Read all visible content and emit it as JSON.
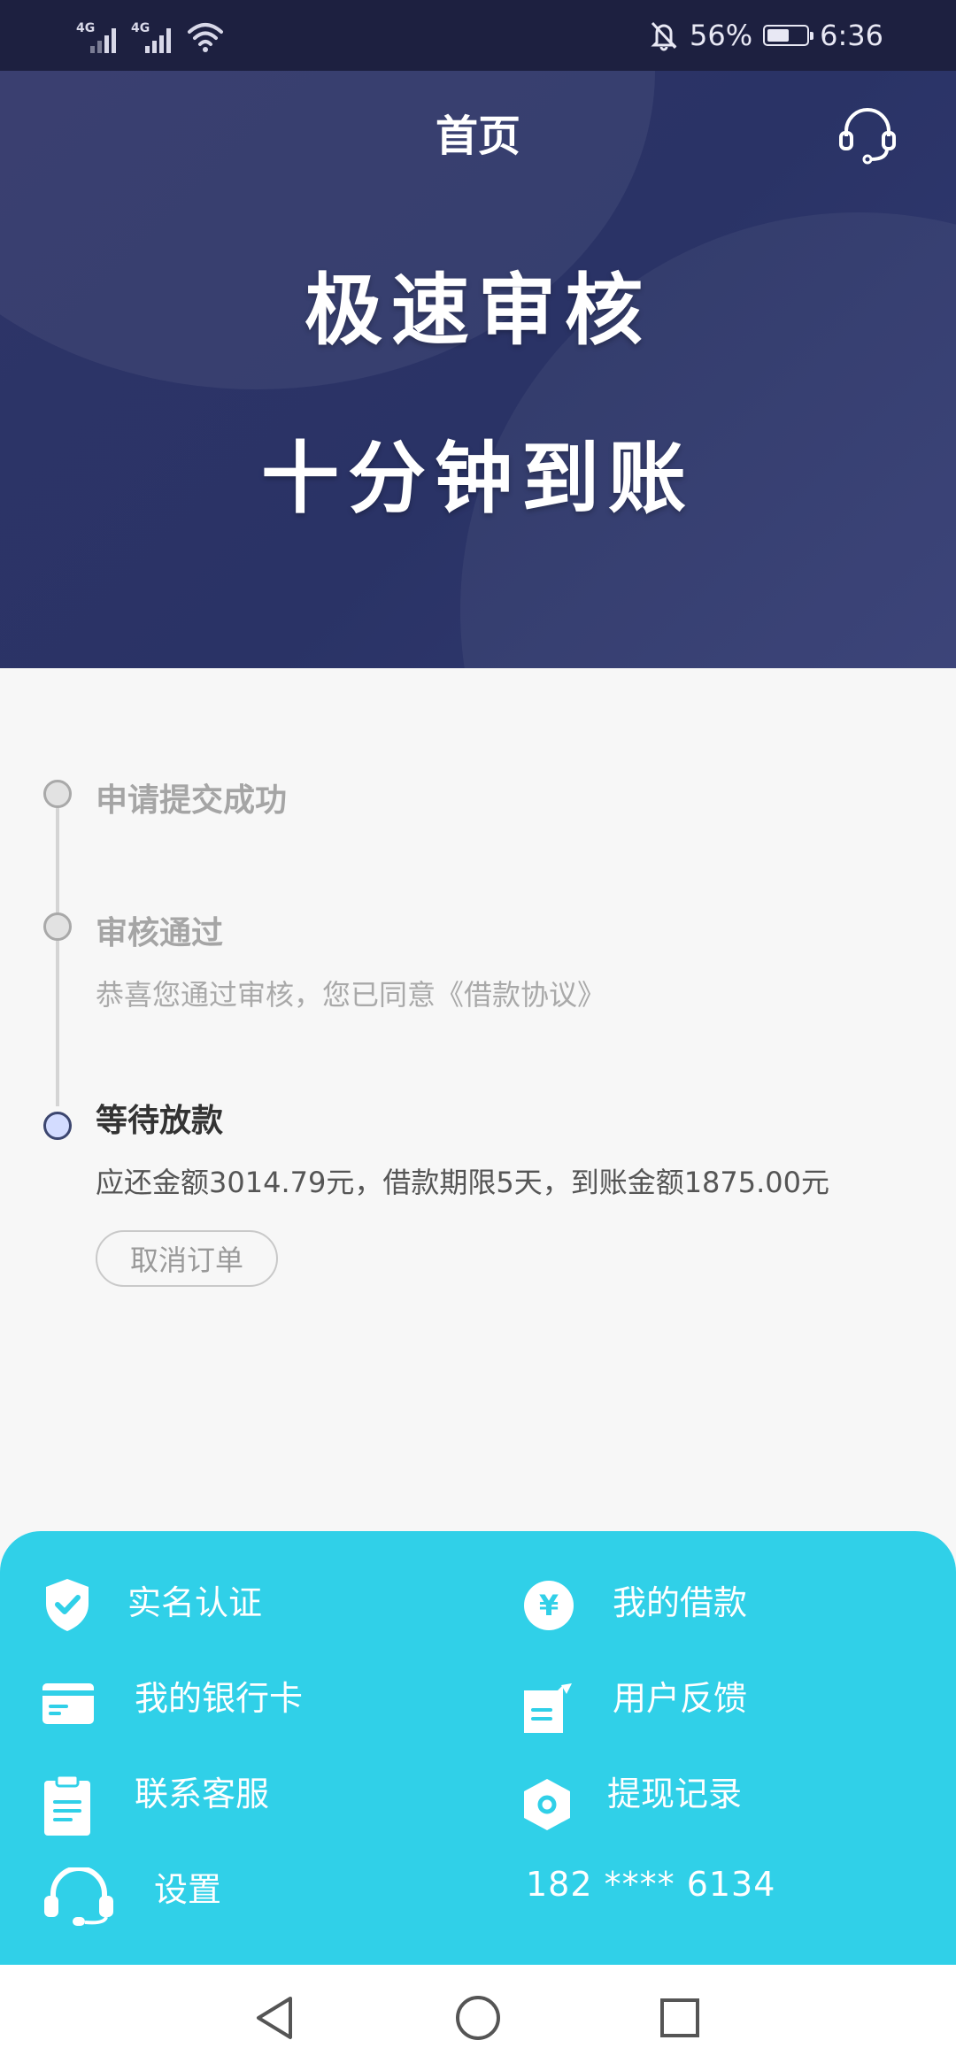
{
  "status_bar": {
    "signal1_label": "4G",
    "signal2_label": "4G",
    "battery_percent": "56%",
    "battery_level": 0.56,
    "time": "6:36"
  },
  "header": {
    "title": "首页",
    "support_icon": "headset-icon"
  },
  "banner": {
    "line1": "极速审核",
    "line2": "十分钟到账"
  },
  "timeline": {
    "steps": [
      {
        "title": "申请提交成功",
        "desc": "",
        "state": "done"
      },
      {
        "title": "审核通过",
        "desc": "恭喜您通过审核，您已同意《借款协议》",
        "state": "done"
      },
      {
        "title": "等待放款",
        "desc": "应还金额3014.79元，借款期限5天，到账金额1875.00元",
        "state": "active"
      }
    ],
    "cancel_label": "取消订单"
  },
  "menu": {
    "items": [
      {
        "label": "实名认证",
        "icon": "shield-check-icon"
      },
      {
        "label": "我的借款",
        "icon": "yen-coin-icon"
      },
      {
        "label": "我的银行卡",
        "icon": "bank-card-icon"
      },
      {
        "label": "用户反馈",
        "icon": "feedback-note-icon"
      },
      {
        "label": "联系客服",
        "icon": "clipboard-icon"
      },
      {
        "label": "提现记录",
        "icon": "hexagon-record-icon"
      },
      {
        "label": "设置",
        "icon": "headset-icon"
      }
    ],
    "phone": "182 **** 6134"
  },
  "colors": {
    "header_bg": "#2b3366",
    "menu_bg": "#30d0e8",
    "page_bg": "#f7f7f7",
    "active_dot": "#d3dcff"
  }
}
